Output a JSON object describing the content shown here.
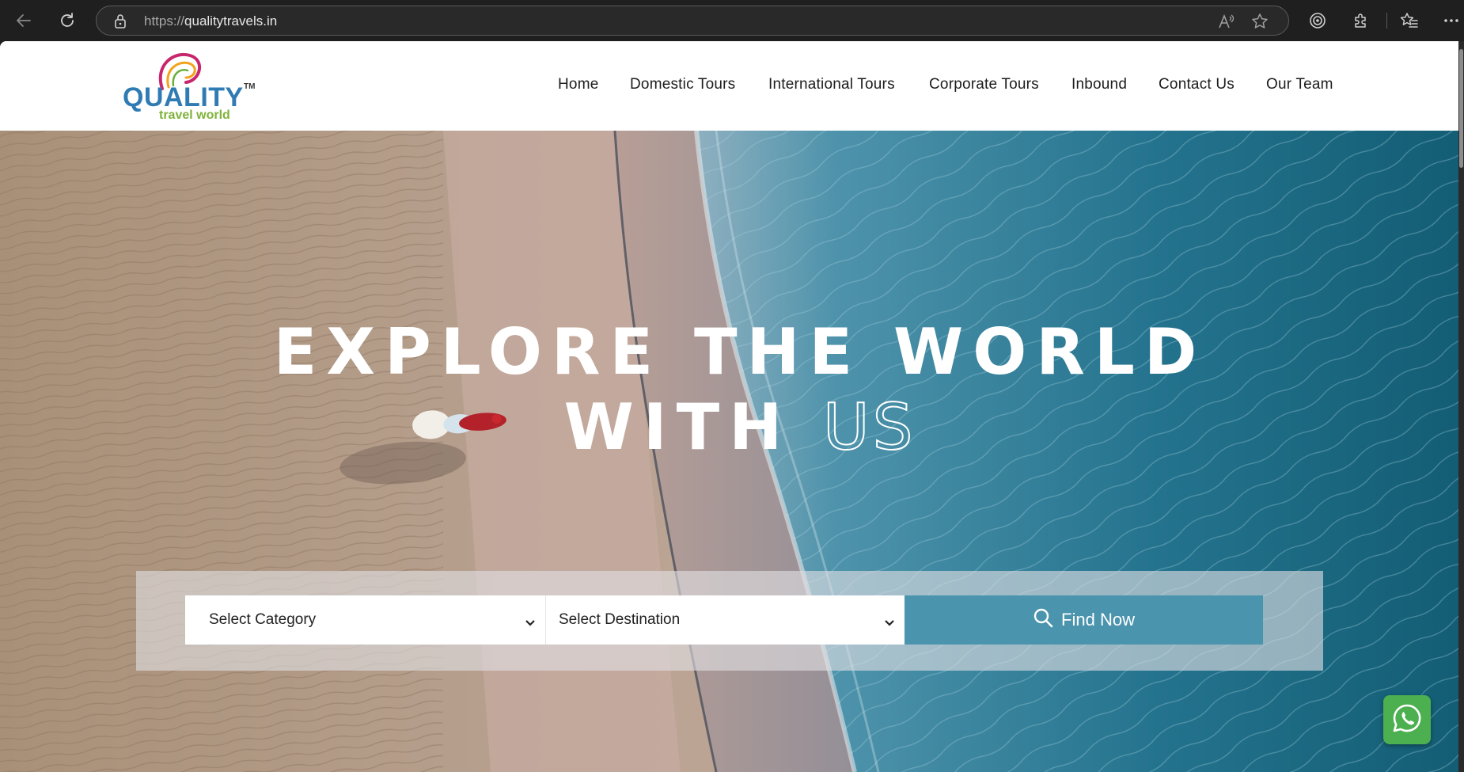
{
  "browser": {
    "url_scheme": "https://",
    "url_host": "qualitytravels.in"
  },
  "logo": {
    "name": "QUALITY",
    "tagline": "travel world",
    "trademark": "TM"
  },
  "nav": {
    "items": [
      {
        "label": "Home"
      },
      {
        "label": "Domestic Tours"
      },
      {
        "label": "International Tours"
      },
      {
        "label": "Corporate Tours"
      },
      {
        "label": "Inbound"
      },
      {
        "label": "Contact Us"
      },
      {
        "label": "Our Team"
      }
    ]
  },
  "hero": {
    "line1": "EXPLORE THE WORLD",
    "line2_solid": "WITH",
    "line2_outline": "US"
  },
  "search": {
    "category_selected": "Select Category",
    "destination_selected": "Select Destination",
    "button_label": "Find Now"
  },
  "colors": {
    "accent": "#4a94ae",
    "whatsapp": "#4caf50",
    "logo_blue": "#2f7bb3",
    "logo_green": "#7fb23a"
  },
  "icons": {
    "back": "back-arrow-icon",
    "refresh": "refresh-icon",
    "lock": "lock-icon",
    "read_aloud": "read-aloud-icon",
    "favorite": "star-icon",
    "tracking": "tracking-prevention-icon",
    "extensions": "extensions-icon",
    "favorites": "favorites-icon",
    "more": "more-icon",
    "search": "search-icon",
    "whatsapp": "whatsapp-icon"
  }
}
